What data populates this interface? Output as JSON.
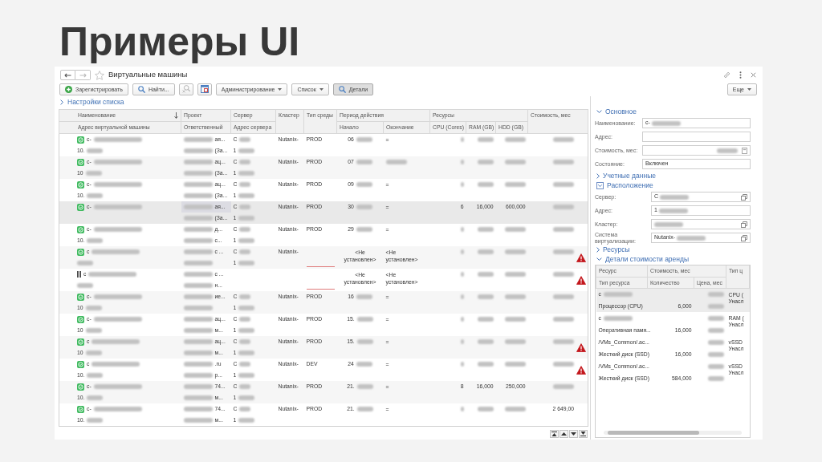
{
  "slide": {
    "title": "Примеры UI"
  },
  "window": {
    "title": "Виртуальные машины",
    "favorite": false,
    "back": {
      "disabled": false
    },
    "forward": {
      "disabled": true
    }
  },
  "toolbar": [
    {
      "kind": "add",
      "label": "Зарегистрировать",
      "disabled": false,
      "pressed": false
    },
    {
      "kind": "find",
      "label": "Найти...",
      "disabled": false,
      "pressed": false
    },
    {
      "kind": "unfind",
      "disabled": true,
      "pressed": false
    },
    {
      "kind": "window",
      "disabled": false,
      "pressed": false
    },
    {
      "kind": "menu",
      "label": "Администрирование",
      "disabled": false,
      "pressed": false
    },
    {
      "kind": "menu",
      "label": "Список",
      "disabled": false,
      "pressed": false
    },
    {
      "kind": "find",
      "label": "Детали",
      "disabled": false,
      "pressed": true
    }
  ],
  "more_button": {
    "label": "Еще"
  },
  "list_settings": {
    "label": "Настройки списка",
    "expanded": false
  },
  "table": {
    "columns": [
      {
        "label": "Наименование",
        "sub": "Адрес виртуальной машины",
        "sorted": true
      },
      {
        "label": "Проект",
        "sub": "Ответственный",
        "sorted": false
      },
      {
        "label": "Сервер",
        "sub": "Адрес сервера",
        "sorted": false
      },
      {
        "label": "Кластер",
        "sorted": false
      },
      {
        "label": "Тип среды",
        "sorted": false
      },
      {
        "label": "Период действия",
        "colspan": 2,
        "children": [
          "Начало",
          "Окончание"
        ],
        "sorted": false
      },
      {
        "label": "Ресурсы",
        "colspan": 3,
        "children": [
          "CPU (Cores)",
          "RAM (GB)",
          "HDD (GB)"
        ],
        "sorted": false
      },
      {
        "label": "Стоимость, мес",
        "sorted": false
      }
    ],
    "rows": [
      {
        "paused": false,
        "selected": false,
        "warning": false,
        "cells": [
          [
            {
              "text": "c-",
              "blur_after": true
            },
            {
              "text": "10.",
              "blur_after": true
            }
          ],
          [
            {
              "text": "ая...",
              "blur_before": true
            },
            {
              "text": "(За...",
              "blur_before": true
            }
          ],
          [
            {
              "text": "C",
              "blur_after": true
            },
            {
              "text": "1",
              "blur_after": true
            }
          ],
          "Nutanix-",
          "PROD",
          {
            "text": "06",
            "blur_after": true
          },
          "=",
          {
            "blurred": true
          },
          {
            "blurred": true
          },
          {
            "blurred": true
          },
          {
            "blurred": true
          }
        ]
      },
      {
        "paused": false,
        "selected": false,
        "warning": false,
        "cells": [
          [
            {
              "text": "c-",
              "blur_after": true
            },
            {
              "text": "10",
              "blur_after": true
            }
          ],
          [
            {
              "text": "ац...",
              "blur_before": true
            },
            {
              "text": "(За...",
              "blur_before": true
            }
          ],
          [
            {
              "text": "C",
              "blur_after": true
            },
            {
              "text": "1",
              "blur_after": true
            }
          ],
          "Nutanix-",
          "PROD",
          {
            "text": "07",
            "blur_after": true
          },
          {
            "blurred": true
          },
          {
            "blurred": true
          },
          {
            "blurred": true
          },
          {
            "blurred": true
          },
          {
            "blurred": true
          }
        ]
      },
      {
        "paused": false,
        "selected": false,
        "warning": false,
        "cells": [
          [
            {
              "text": "c-",
              "blur_after": true
            },
            {
              "text": "10.",
              "blur_after": true
            }
          ],
          [
            {
              "text": "ац...",
              "blur_before": true
            },
            {
              "text": "(За...",
              "blur_before": true
            }
          ],
          [
            {
              "text": "C",
              "blur_after": true
            },
            {
              "text": "1",
              "blur_after": true
            }
          ],
          "Nutanix-",
          "PROD",
          {
            "text": "09",
            "blur_after": true
          },
          "=",
          {
            "blurred": true
          },
          {
            "blurred": true
          },
          {
            "blurred": true
          },
          {
            "blurred": true
          }
        ]
      },
      {
        "paused": false,
        "selected": true,
        "warning": false,
        "cells": [
          [
            {
              "text": "c-",
              "blur_after": true
            },
            null
          ],
          [
            {
              "text": "ая...",
              "blur_before": true,
              "focused": true
            },
            {
              "text": "(За...",
              "blur_before": true
            }
          ],
          [
            {
              "text": "C",
              "blur_after": true
            },
            {
              "text": "1",
              "blur_after": true
            }
          ],
          "Nutanix-",
          "PROD",
          {
            "text": "30",
            "blur_after": true
          },
          "=",
          "6",
          "16,000",
          "600,000",
          {
            "blurred": true
          }
        ]
      },
      {
        "paused": false,
        "selected": false,
        "warning": false,
        "cells": [
          [
            {
              "text": "c-",
              "blur_after": true
            },
            {
              "text": "10.",
              "blur_after": true
            }
          ],
          [
            {
              "text": "д...",
              "blur_before": true
            },
            {
              "text": "с...",
              "blur_before": true
            }
          ],
          [
            {
              "text": "C",
              "blur_after": true
            },
            {
              "text": "1",
              "blur_after": true
            }
          ],
          "Nutanix-",
          "PROD",
          {
            "text": "29",
            "blur_after": true
          },
          "=",
          {
            "blurred": true
          },
          {
            "blurred": true
          },
          {
            "blurred": true
          },
          {
            "blurred": true
          }
        ]
      },
      {
        "paused": false,
        "selected": false,
        "warning": true,
        "cells": [
          [
            {
              "text": "c",
              "blur_after": true
            },
            {
              "blurred": true
            }
          ],
          [
            {
              "text": "с ...",
              "blur_before": true
            },
            {
              "blurred": true
            }
          ],
          [
            {
              "text": "C",
              "blur_after": true
            },
            {
              "text": "1",
              "blur_after": true
            }
          ],
          "Nutanix-",
          {
            "missing": true
          },
          "<Не установлен>",
          "<Не установлен>",
          {
            "blurred": true
          },
          {
            "blurred": true
          },
          {
            "blurred": true
          },
          {
            "blurred": true
          }
        ]
      },
      {
        "paused": true,
        "selected": false,
        "warning": true,
        "cells": [
          [
            {
              "text": "c",
              "blur_after": true
            },
            {
              "blurred": true
            }
          ],
          [
            {
              "text": "с ...",
              "blur_before": true
            },
            {
              "text": "н...",
              "blur_before": true
            }
          ],
          [
            null,
            null
          ],
          null,
          {
            "missing": true
          },
          "<Не установлен>",
          "<Не установлен>",
          {
            "blurred": true
          },
          {
            "blurred": true
          },
          {
            "blurred": true
          },
          {
            "blurred": true
          }
        ]
      },
      {
        "paused": false,
        "selected": false,
        "warning": false,
        "cells": [
          [
            {
              "text": "c-",
              "blur_after": true
            },
            {
              "text": "10",
              "blur_after": true
            }
          ],
          [
            {
              "text": "ие...",
              "blur_before": true
            },
            {
              "blurred": true
            }
          ],
          [
            {
              "text": "C",
              "blur_after": true
            },
            {
              "text": "1",
              "blur_after": true
            }
          ],
          "Nutanix-",
          "PROD",
          {
            "text": "16",
            "blur_after": true
          },
          "=",
          {
            "blurred": true
          },
          {
            "blurred": true
          },
          {
            "blurred": true
          },
          {
            "blurred": true
          }
        ]
      },
      {
        "paused": false,
        "selected": false,
        "warning": false,
        "cells": [
          [
            {
              "text": "c-",
              "blur_after": true
            },
            {
              "text": "10",
              "blur_after": true
            }
          ],
          [
            {
              "text": "ац...",
              "blur_before": true
            },
            {
              "text": "м...",
              "blur_before": true
            }
          ],
          [
            {
              "text": "C",
              "blur_after": true
            },
            {
              "text": "1",
              "blur_after": true
            }
          ],
          "Nutanix-",
          "PROD",
          {
            "text": "15.",
            "blur_after": true
          },
          "=",
          {
            "blurred": true
          },
          {
            "blurred": true
          },
          {
            "blurred": true
          },
          {
            "blurred": true
          }
        ]
      },
      {
        "paused": false,
        "selected": false,
        "warning": true,
        "cells": [
          [
            {
              "text": "c",
              "blur_after": true
            },
            {
              "text": "10",
              "blur_after": true
            }
          ],
          [
            {
              "text": "ац...",
              "blur_before": true
            },
            {
              "text": "м...",
              "blur_before": true
            }
          ],
          [
            {
              "text": "C",
              "blur_after": true
            },
            {
              "text": "1",
              "blur_after": true
            }
          ],
          "Nutanix-",
          "PROD",
          {
            "text": "15.",
            "blur_after": true
          },
          "=",
          {
            "blurred": true
          },
          {
            "blurred": true
          },
          {
            "blurred": true
          },
          {
            "blurred": true
          }
        ]
      },
      {
        "paused": false,
        "selected": false,
        "warning": true,
        "cells": [
          [
            {
              "text": "c",
              "blur_after": true
            },
            {
              "text": "10.",
              "blur_after": true
            }
          ],
          [
            {
              "text": ".ru",
              "blur_before": true
            },
            {
              "text": "р...",
              "blur_before": true
            }
          ],
          [
            {
              "text": "C",
              "blur_after": true
            },
            {
              "text": "1",
              "blur_after": true
            }
          ],
          "Nutanix-",
          "DEV",
          {
            "text": "24",
            "blur_after": true
          },
          "=",
          {
            "blurred": true
          },
          {
            "blurred": true
          },
          {
            "blurred": true
          },
          {
            "blurred": true
          }
        ]
      },
      {
        "paused": false,
        "selected": false,
        "warning": false,
        "cells": [
          [
            {
              "text": "c-",
              "blur_after": true
            },
            {
              "text": "10.",
              "blur_after": true
            }
          ],
          [
            {
              "text": "74...",
              "blur_before": true
            },
            {
              "text": "м...",
              "blur_before": true
            }
          ],
          [
            {
              "text": "C",
              "blur_after": true
            },
            {
              "text": "1",
              "blur_after": true
            }
          ],
          "Nutanix-",
          "PROD",
          {
            "text": "21.",
            "blur_after": true
          },
          "=",
          "8",
          "16,000",
          "250,000",
          {
            "blurred": true
          }
        ]
      },
      {
        "paused": false,
        "selected": false,
        "warning": false,
        "cells": [
          [
            {
              "text": "c-",
              "blur_after": true
            },
            {
              "text": "10.",
              "blur_after": true
            }
          ],
          [
            {
              "text": "74...",
              "blur_before": true
            },
            {
              "text": "м...",
              "blur_before": true
            }
          ],
          [
            {
              "text": "C",
              "blur_after": true
            },
            {
              "text": "1",
              "blur_after": true
            }
          ],
          "Nutanix-",
          "PROD",
          {
            "text": "21.",
            "blur_after": true
          },
          "=",
          {
            "blurred": true
          },
          {
            "blurred": true
          },
          {
            "blurred": true
          },
          "2 649,00"
        ]
      }
    ]
  },
  "details": {
    "sections": [
      {
        "title": "Основное",
        "expanded": true,
        "focused": false,
        "fields": [
          {
            "kind": "plain",
            "label": "Наименование:",
            "value": {
              "text": "c-",
              "blur_after": true
            }
          },
          {
            "kind": "plain",
            "label": "Адрес:"
          },
          {
            "kind": "calculator",
            "label": "Стоимость, мес:",
            "value": {
              "blurred": true
            }
          },
          {
            "kind": "plain",
            "label": "Состояние:",
            "value": "Включен"
          }
        ]
      },
      {
        "title": "Учетные данные",
        "expanded": false,
        "focused": false
      },
      {
        "title": "Расположение",
        "expanded": true,
        "focused": true,
        "fields": [
          {
            "kind": "open",
            "label": "Сервер:",
            "value": {
              "text": "C",
              "blur_after": true
            }
          },
          {
            "kind": "plain",
            "label": "Адрес:",
            "value": {
              "text": "1",
              "blur_after": true
            }
          },
          {
            "kind": "open",
            "label": "Кластер:",
            "value": {
              "blurred": true
            }
          },
          {
            "kind": "open",
            "label": "Система виртуализации:",
            "value": {
              "text": "Nutanix-",
              "blur_after": true
            }
          }
        ]
      },
      {
        "title": "Ресурсы",
        "expanded": false,
        "focused": false
      },
      {
        "title": "Детали стоимости аренды",
        "expanded": true,
        "focused": false,
        "table": {
          "columns": [
            {
              "label": "Ресурс",
              "sub": "Тип ресурса"
            },
            {
              "label": "Стоимость, мес",
              "colspan": 2,
              "children": [
                "Количество",
                "Цена, мес"
              ]
            },
            {
              "label": "Тип ц"
            }
          ],
          "rows": [
            {
              "selected": true,
              "resource": {
                "text": "c",
                "blur_after": true
              },
              "cost": {
                "blurred": true
              },
              "type_lines": [
                "CPU (",
                "Унасл"
              ],
              "resource_type": "Процессор (CPU)",
              "quantity": "6,000",
              "price": {
                "blurred": true
              }
            },
            {
              "selected": false,
              "resource": {
                "text": "c",
                "blur_after": true
              },
              "cost": {
                "blurred": true
              },
              "type_lines": [
                "RAM (",
                "Унасл"
              ],
              "resource_type": "Оперативная памя...",
              "quantity": "16,000",
              "price": {
                "blurred": true
              }
            },
            {
              "selected": false,
              "resource": "/VMs_Common/.ac...",
              "cost": {
                "blurred": true
              },
              "type_lines": [
                "vSSD",
                "Унасл"
              ],
              "resource_type": "Жесткий диск (SSD)",
              "quantity": "16,000",
              "price": {
                "blurred": true
              }
            },
            {
              "selected": false,
              "resource": "/VMs_Common/.ac...",
              "cost": {
                "blurred": true
              },
              "type_lines": [
                "vSSD",
                "Унасл"
              ],
              "resource_type": "Жесткий диск (SSD)",
              "quantity": "584,000",
              "price": {
                "blurred": true
              }
            }
          ]
        }
      }
    ]
  }
}
